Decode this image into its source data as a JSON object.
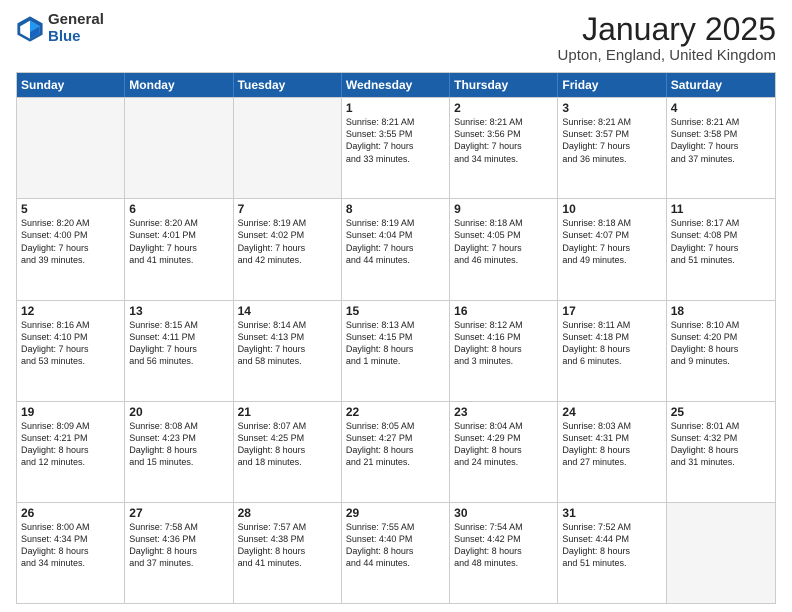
{
  "logo": {
    "general": "General",
    "blue": "Blue"
  },
  "title": "January 2025",
  "subtitle": "Upton, England, United Kingdom",
  "days": [
    "Sunday",
    "Monday",
    "Tuesday",
    "Wednesday",
    "Thursday",
    "Friday",
    "Saturday"
  ],
  "weeks": [
    [
      {
        "day": "",
        "empty": true
      },
      {
        "day": "",
        "empty": true
      },
      {
        "day": "",
        "empty": true
      },
      {
        "day": "1",
        "lines": [
          "Sunrise: 8:21 AM",
          "Sunset: 3:55 PM",
          "Daylight: 7 hours",
          "and 33 minutes."
        ]
      },
      {
        "day": "2",
        "lines": [
          "Sunrise: 8:21 AM",
          "Sunset: 3:56 PM",
          "Daylight: 7 hours",
          "and 34 minutes."
        ]
      },
      {
        "day": "3",
        "lines": [
          "Sunrise: 8:21 AM",
          "Sunset: 3:57 PM",
          "Daylight: 7 hours",
          "and 36 minutes."
        ]
      },
      {
        "day": "4",
        "lines": [
          "Sunrise: 8:21 AM",
          "Sunset: 3:58 PM",
          "Daylight: 7 hours",
          "and 37 minutes."
        ]
      }
    ],
    [
      {
        "day": "5",
        "lines": [
          "Sunrise: 8:20 AM",
          "Sunset: 4:00 PM",
          "Daylight: 7 hours",
          "and 39 minutes."
        ]
      },
      {
        "day": "6",
        "lines": [
          "Sunrise: 8:20 AM",
          "Sunset: 4:01 PM",
          "Daylight: 7 hours",
          "and 41 minutes."
        ]
      },
      {
        "day": "7",
        "lines": [
          "Sunrise: 8:19 AM",
          "Sunset: 4:02 PM",
          "Daylight: 7 hours",
          "and 42 minutes."
        ]
      },
      {
        "day": "8",
        "lines": [
          "Sunrise: 8:19 AM",
          "Sunset: 4:04 PM",
          "Daylight: 7 hours",
          "and 44 minutes."
        ]
      },
      {
        "day": "9",
        "lines": [
          "Sunrise: 8:18 AM",
          "Sunset: 4:05 PM",
          "Daylight: 7 hours",
          "and 46 minutes."
        ]
      },
      {
        "day": "10",
        "lines": [
          "Sunrise: 8:18 AM",
          "Sunset: 4:07 PM",
          "Daylight: 7 hours",
          "and 49 minutes."
        ]
      },
      {
        "day": "11",
        "lines": [
          "Sunrise: 8:17 AM",
          "Sunset: 4:08 PM",
          "Daylight: 7 hours",
          "and 51 minutes."
        ]
      }
    ],
    [
      {
        "day": "12",
        "lines": [
          "Sunrise: 8:16 AM",
          "Sunset: 4:10 PM",
          "Daylight: 7 hours",
          "and 53 minutes."
        ]
      },
      {
        "day": "13",
        "lines": [
          "Sunrise: 8:15 AM",
          "Sunset: 4:11 PM",
          "Daylight: 7 hours",
          "and 56 minutes."
        ]
      },
      {
        "day": "14",
        "lines": [
          "Sunrise: 8:14 AM",
          "Sunset: 4:13 PM",
          "Daylight: 7 hours",
          "and 58 minutes."
        ]
      },
      {
        "day": "15",
        "lines": [
          "Sunrise: 8:13 AM",
          "Sunset: 4:15 PM",
          "Daylight: 8 hours",
          "and 1 minute."
        ]
      },
      {
        "day": "16",
        "lines": [
          "Sunrise: 8:12 AM",
          "Sunset: 4:16 PM",
          "Daylight: 8 hours",
          "and 3 minutes."
        ]
      },
      {
        "day": "17",
        "lines": [
          "Sunrise: 8:11 AM",
          "Sunset: 4:18 PM",
          "Daylight: 8 hours",
          "and 6 minutes."
        ]
      },
      {
        "day": "18",
        "lines": [
          "Sunrise: 8:10 AM",
          "Sunset: 4:20 PM",
          "Daylight: 8 hours",
          "and 9 minutes."
        ]
      }
    ],
    [
      {
        "day": "19",
        "lines": [
          "Sunrise: 8:09 AM",
          "Sunset: 4:21 PM",
          "Daylight: 8 hours",
          "and 12 minutes."
        ]
      },
      {
        "day": "20",
        "lines": [
          "Sunrise: 8:08 AM",
          "Sunset: 4:23 PM",
          "Daylight: 8 hours",
          "and 15 minutes."
        ]
      },
      {
        "day": "21",
        "lines": [
          "Sunrise: 8:07 AM",
          "Sunset: 4:25 PM",
          "Daylight: 8 hours",
          "and 18 minutes."
        ]
      },
      {
        "day": "22",
        "lines": [
          "Sunrise: 8:05 AM",
          "Sunset: 4:27 PM",
          "Daylight: 8 hours",
          "and 21 minutes."
        ]
      },
      {
        "day": "23",
        "lines": [
          "Sunrise: 8:04 AM",
          "Sunset: 4:29 PM",
          "Daylight: 8 hours",
          "and 24 minutes."
        ]
      },
      {
        "day": "24",
        "lines": [
          "Sunrise: 8:03 AM",
          "Sunset: 4:31 PM",
          "Daylight: 8 hours",
          "and 27 minutes."
        ]
      },
      {
        "day": "25",
        "lines": [
          "Sunrise: 8:01 AM",
          "Sunset: 4:32 PM",
          "Daylight: 8 hours",
          "and 31 minutes."
        ]
      }
    ],
    [
      {
        "day": "26",
        "lines": [
          "Sunrise: 8:00 AM",
          "Sunset: 4:34 PM",
          "Daylight: 8 hours",
          "and 34 minutes."
        ]
      },
      {
        "day": "27",
        "lines": [
          "Sunrise: 7:58 AM",
          "Sunset: 4:36 PM",
          "Daylight: 8 hours",
          "and 37 minutes."
        ]
      },
      {
        "day": "28",
        "lines": [
          "Sunrise: 7:57 AM",
          "Sunset: 4:38 PM",
          "Daylight: 8 hours",
          "and 41 minutes."
        ]
      },
      {
        "day": "29",
        "lines": [
          "Sunrise: 7:55 AM",
          "Sunset: 4:40 PM",
          "Daylight: 8 hours",
          "and 44 minutes."
        ]
      },
      {
        "day": "30",
        "lines": [
          "Sunrise: 7:54 AM",
          "Sunset: 4:42 PM",
          "Daylight: 8 hours",
          "and 48 minutes."
        ]
      },
      {
        "day": "31",
        "lines": [
          "Sunrise: 7:52 AM",
          "Sunset: 4:44 PM",
          "Daylight: 8 hours",
          "and 51 minutes."
        ]
      },
      {
        "day": "",
        "empty": true
      }
    ]
  ]
}
